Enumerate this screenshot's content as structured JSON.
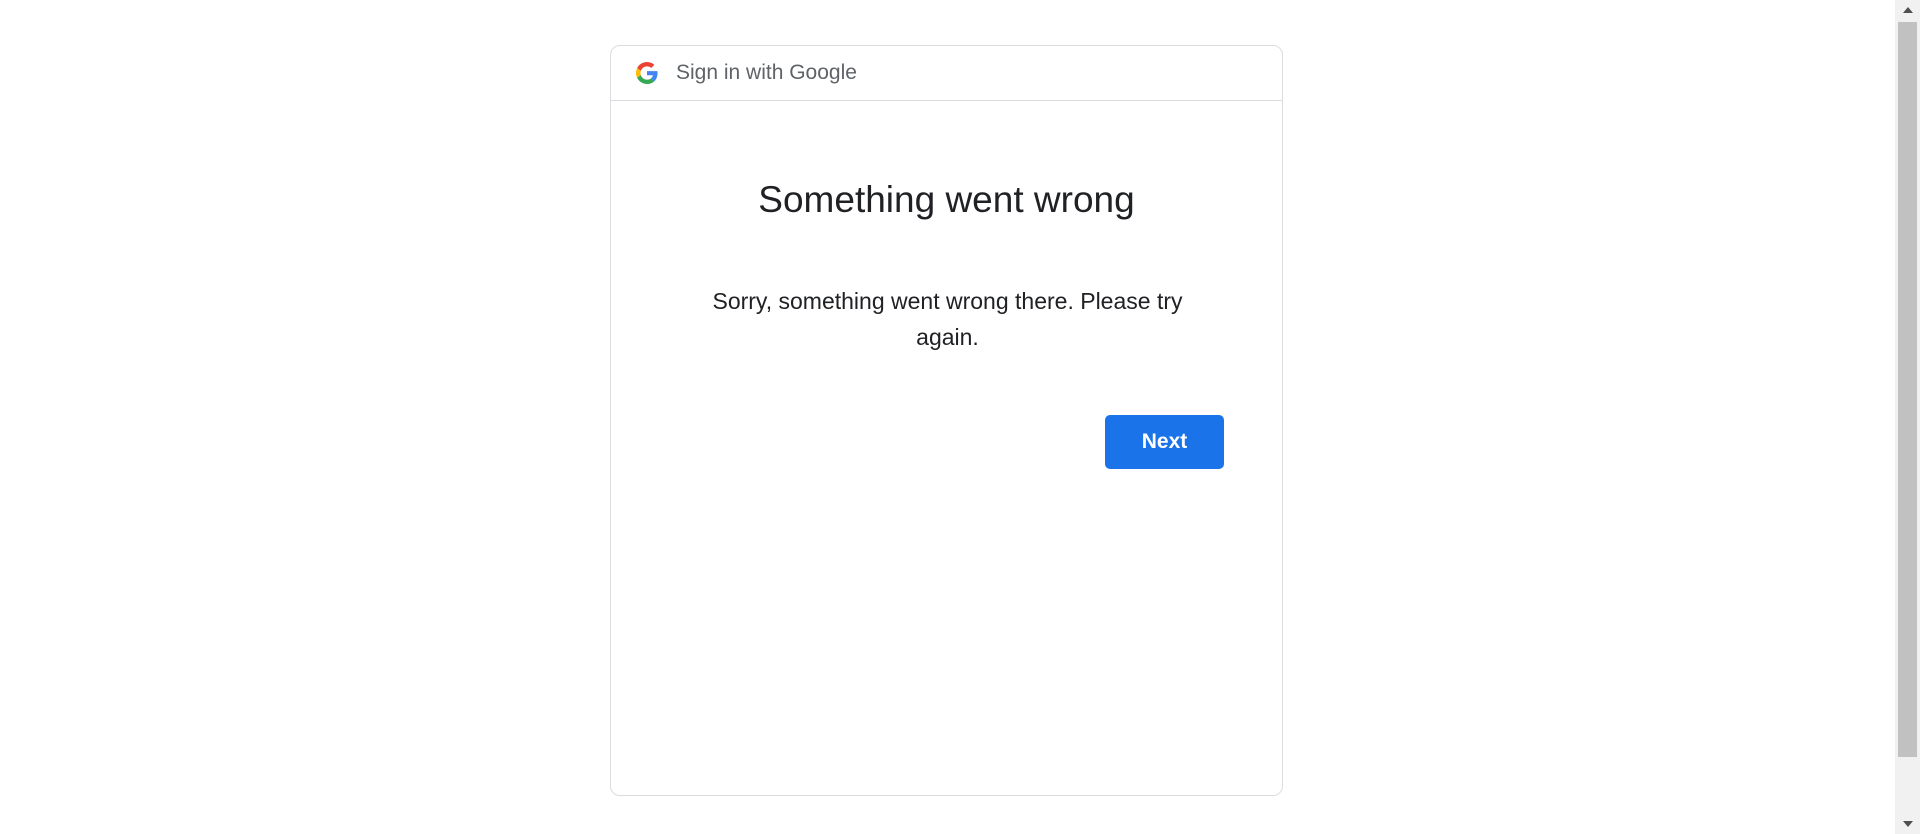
{
  "header": {
    "title": "Sign in with Google",
    "logo_icon": "google-g-icon"
  },
  "main": {
    "error_title": "Something went wrong",
    "error_message": "Sorry, something went wrong there. Please try again.",
    "next_label": "Next"
  },
  "colors": {
    "accent": "#1a73e8",
    "text_primary": "#202124",
    "text_secondary": "#5f6368",
    "border": "#dadce0"
  },
  "scrollbar": {
    "up_icon": "scroll-up-arrow-icon",
    "down_icon": "scroll-down-arrow-icon"
  }
}
